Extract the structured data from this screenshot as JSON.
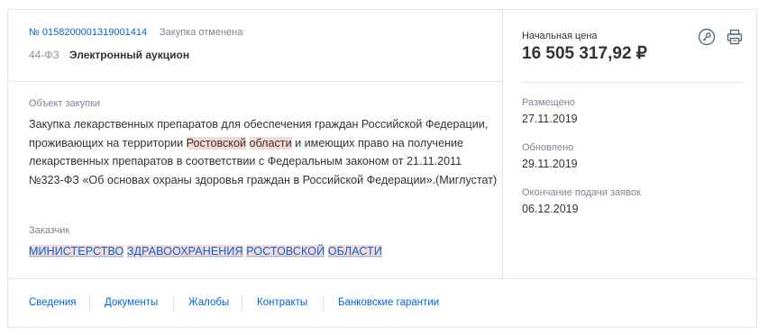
{
  "purchase": {
    "number": "№ 0158200001319001414",
    "status": "Закупка отменена",
    "law": "44-ФЗ",
    "method": "Электронный аукцион"
  },
  "object": {
    "label": "Объект закупки",
    "text_part1": "Закупка лекарственных препаратов для обеспечения граждан Российской Федерации, проживающих на территории ",
    "highlight1": "Ростовской",
    "space": " ",
    "highlight2": "области",
    "text_part2": " и имеющих право на получение лекарственных препаратов в соответствии с Федеральным законом от 21.11.2011 №323-ФЗ «Об основах охраны здоровья граждан в Российской Федерации».(Миглустат)"
  },
  "customer": {
    "label": "Заказчик",
    "words": [
      "МИНИСТЕРСТВО",
      "ЗДРАВООХРАНЕНИЯ",
      "РОСТОВСКОЙ",
      "ОБЛАСТИ"
    ]
  },
  "price": {
    "label": "Начальная цена",
    "value": "16 505 317,92 ₽"
  },
  "dates": {
    "posted_label": "Размещено",
    "posted_value": "27.11.2019",
    "updated_label": "Обновлено",
    "updated_value": "29.11.2019",
    "deadline_label": "Окончание подачи заявок",
    "deadline_value": "06.12.2019"
  },
  "tabs": [
    "Сведения",
    "Документы",
    "Жалобы",
    "Контракты",
    "Банковские гарантии"
  ],
  "icons": {
    "key": "key-icon",
    "print": "printer-icon"
  },
  "colors": {
    "link": "#0065dd",
    "highlight": "#f7d9d6",
    "muted": "#7a8694",
    "border": "#e3e6ea"
  }
}
